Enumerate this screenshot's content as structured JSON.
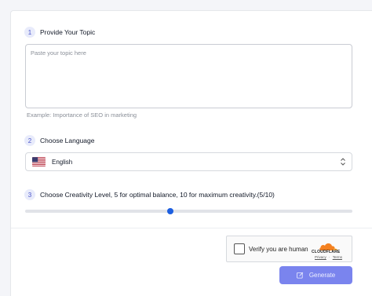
{
  "steps": [
    {
      "num": "1",
      "label": "Provide Your Topic"
    },
    {
      "num": "2",
      "label": "Choose Language"
    },
    {
      "num": "3",
      "label": "Choose Creativity Level, 5 for optimal balance, 10 for maximum creativity.(5/10)"
    }
  ],
  "topic": {
    "value": "",
    "placeholder": "Paste your topic here",
    "example": "Example:  Importance of SEO in marketing"
  },
  "language": {
    "selected": "English",
    "flag_icon": "us-flag-icon"
  },
  "creativity": {
    "value": 5,
    "min": 1,
    "max": 10
  },
  "captcha": {
    "label": "Verify you are human",
    "brand": "CLOUDFLARE",
    "privacy": "Privacy",
    "separator": "·",
    "terms": "Terms"
  },
  "actions": {
    "generate_label": "Generate",
    "generate_icon": "edit-icon"
  },
  "colors": {
    "accent": "#1d5fe0",
    "button": "#7a84ee",
    "step_badge_bg": "#e8ebfb",
    "cloudflare_orange": "#f48120"
  }
}
